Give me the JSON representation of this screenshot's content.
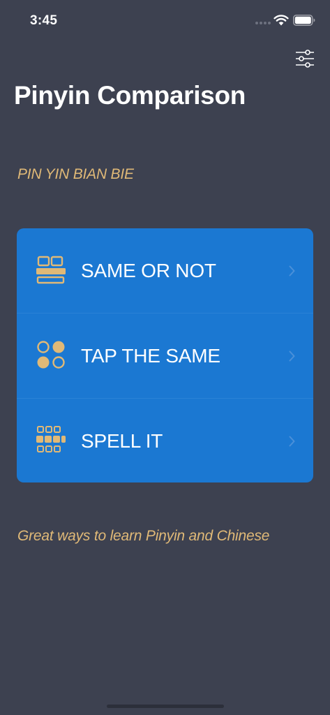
{
  "status_bar": {
    "time": "3:45"
  },
  "header": {
    "title": "Pinyin Comparison",
    "settings_icon": "sliders-icon"
  },
  "subtitle": "PIN YIN BIAN BIE",
  "menu": {
    "items": [
      {
        "label": "SAME OR NOT",
        "icon": "same-or-not-icon"
      },
      {
        "label": "TAP THE SAME",
        "icon": "tap-the-same-icon"
      },
      {
        "label": "SPELL IT",
        "icon": "spell-it-icon"
      }
    ]
  },
  "tagline": "Great ways to learn Pinyin and Chinese",
  "colors": {
    "background": "#3d4150",
    "card": "#1b78d2",
    "accent": "#e0b977",
    "text": "#ffffff"
  }
}
